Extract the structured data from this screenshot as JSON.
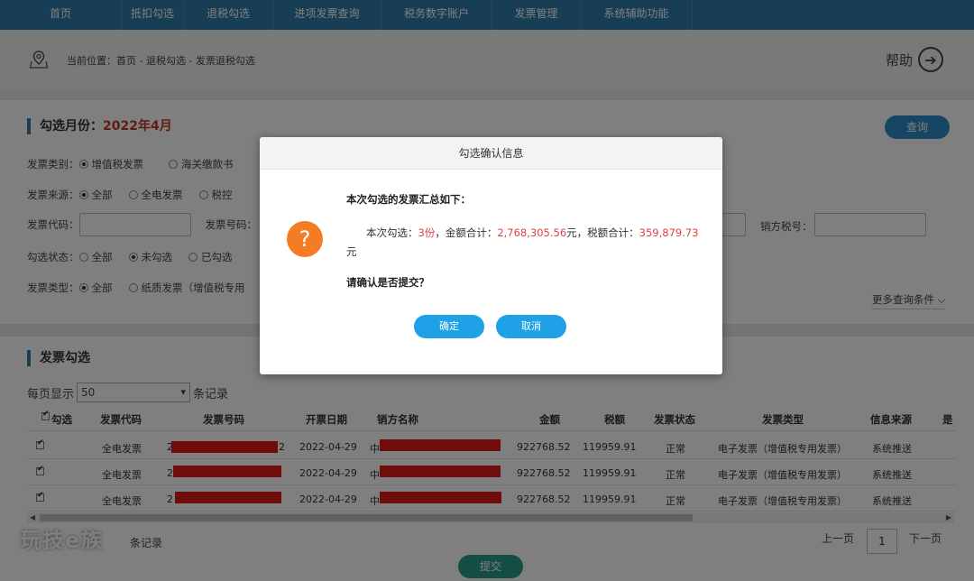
{
  "nav": [
    "首页",
    "抵扣勾选",
    "退税勾选",
    "进项发票查询",
    "税务数字账户",
    "发票管理",
    "系统辅助功能"
  ],
  "breadcrumb": "当前位置：首页 - 退税勾选 - 发票退税勾选",
  "help_label": "帮助",
  "filter": {
    "title_prefix": "勾选月份：",
    "month": "2022年4月",
    "query_button": "查询",
    "rows": [
      {
        "label": "发票类别：",
        "options": [
          {
            "text": "增值税发票",
            "on": true
          },
          {
            "text": "海关缴款书",
            "on": false
          }
        ]
      },
      {
        "label": "发票来源：",
        "options": [
          {
            "text": "全部",
            "on": true
          },
          {
            "text": "全电发票",
            "on": false
          },
          {
            "text": "税控",
            "on": false
          }
        ]
      },
      {
        "label": "勾选状态：",
        "options": [
          {
            "text": "全部",
            "on": false
          },
          {
            "text": "未勾选",
            "on": true
          },
          {
            "text": "已勾选",
            "on": false
          }
        ]
      },
      {
        "label": "发票类型：",
        "options": [
          {
            "text": "全部",
            "on": true
          },
          {
            "text": "纸质发票（增值税专用",
            "on": false
          }
        ]
      }
    ],
    "code_label": "发票代码：",
    "number_label": "发票号码：",
    "seller_tax_label": "销方税号：",
    "more_conditions": "更多查询条件 ⌵"
  },
  "table": {
    "title": "发票勾选",
    "per_page_prefix": "每页显示",
    "per_page_value": "50",
    "per_page_suffix": "条记录",
    "headers": [
      "勾选",
      "发票代码",
      "发票号码",
      "开票日期",
      "销方名称",
      "金额",
      "税额",
      "发票状态",
      "发票类型",
      "信息来源",
      "是"
    ],
    "rows": [
      {
        "code": "全电发票",
        "number_start": "2",
        "number_end": "2",
        "date": "2022-04-29",
        "seller_start": "中",
        "amount": "922768.52",
        "tax": "119959.91",
        "status": "正常",
        "type": "电子发票（增值税专用发票）",
        "source": "系统推送"
      },
      {
        "code": "全电发票",
        "number_start": "2",
        "number_end": "",
        "date": "2022-04-29",
        "seller_start": "中",
        "amount": "922768.52",
        "tax": "119959.91",
        "status": "正常",
        "type": "电子发票（增值税专用发票）",
        "source": "系统推送"
      },
      {
        "code": "全电发票",
        "number_start": "2",
        "number_end": "",
        "date": "2022-04-29",
        "seller_start": "中",
        "amount": "922768.52",
        "tax": "119959.91",
        "status": "正常",
        "type": "电子发票（增值税专用发票）",
        "source": "系统推送"
      }
    ],
    "records_label": "条记录",
    "prev": "上一页",
    "page": "1",
    "next": "下一页",
    "submit": "提交"
  },
  "watermark": "玩技e族",
  "modal": {
    "title": "勾选确认信息",
    "line1": "本次勾选的发票汇总如下：",
    "count_prefix": "本次勾选：",
    "count": "3份",
    "amount_prefix": "，金额合计：",
    "amount": "2,768,305.56",
    "amount_suffix": "元，税额合计：",
    "tax": "359,879.73",
    "tax_suffix": "元",
    "confirm_question": "请确认是否提交？",
    "ok": "确定",
    "cancel": "取消"
  }
}
